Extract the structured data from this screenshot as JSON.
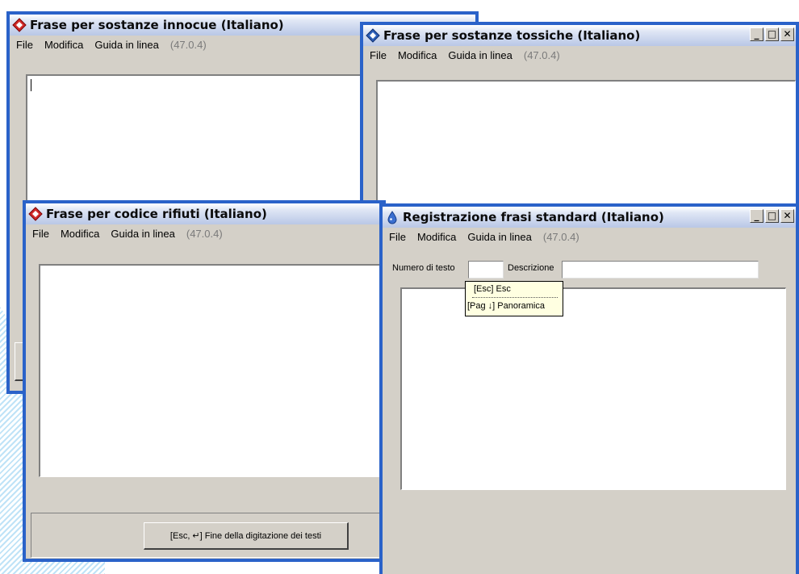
{
  "windows": {
    "innocue": {
      "title": "Frase per sostanze innocue (Italiano)",
      "menu": [
        "File",
        "Modifica",
        "Guida in linea"
      ],
      "version": "(47.0.4)"
    },
    "tossiche": {
      "title": "Frase per sostanze tossiche (Italiano)",
      "menu": [
        "File",
        "Modifica",
        "Guida in linea"
      ],
      "version": "(47.0.4)",
      "controls": {
        "minimize": "_",
        "maximize": "□",
        "close": "✕"
      }
    },
    "rifiuti": {
      "title": "Frase per codice rifiuti (Italiano)",
      "menu": [
        "File",
        "Modifica",
        "Guida in linea"
      ],
      "version": "(47.0.4)",
      "end_button": "[Esc, ↵] Fine della digitazione dei testi"
    },
    "registrazione": {
      "title": "Registrazione frasi standard (Italiano)",
      "menu": [
        "File",
        "Modifica",
        "Guida in linea"
      ],
      "version": "(47.0.4)",
      "controls": {
        "minimize": "_",
        "maximize": "□",
        "close": "✕"
      },
      "numero_label": "Numero di testo",
      "numero_value": "",
      "descrizione_label": "Descrizione",
      "descrizione_value": "",
      "tooltip": {
        "line1": "[Esc]  Esc",
        "line2": "[Pag ↓] Panoramica"
      }
    }
  },
  "colors": {
    "window_border": "#2a62c9",
    "window_face": "#d4d0c8",
    "tooltip_bg": "#ffffe1"
  },
  "icons": {
    "app": "diamond-app-icon",
    "registration": "droplet-app-icon"
  }
}
